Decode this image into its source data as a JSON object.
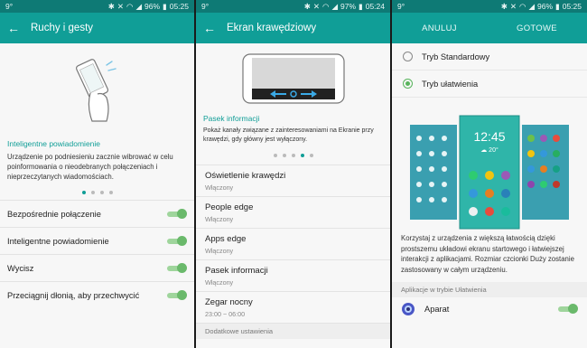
{
  "status1": {
    "left": "9°",
    "battery": "96%",
    "time": "05:25"
  },
  "status2": {
    "left": "9°",
    "battery": "97%",
    "time": "05:24"
  },
  "status3": {
    "left": "9°",
    "battery": "96%",
    "time": "05:25"
  },
  "panel1": {
    "title": "Ruchy i gesty",
    "section": "Inteligentne powiadomienie",
    "description": "Urządzenie po podniesieniu zacznie wibrować w celu poinformowania o nieodebranych połączeniach i nieprzeczytanych wiadomościach.",
    "toggles": [
      {
        "label": "Bezpośrednie połączenie",
        "on": true
      },
      {
        "label": "Inteligentne powiadomienie",
        "on": true
      },
      {
        "label": "Wycisz",
        "on": true
      },
      {
        "label": "Przeciągnij dłonią, aby przechwycić",
        "on": true
      }
    ]
  },
  "panel2": {
    "title": "Ekran krawędziowy",
    "section": "Pasek informacji",
    "description": "Pokaż kanały związane z zainteresowaniami na Ekranie przy krawędzi, gdy główny jest wyłączony.",
    "items": [
      {
        "title": "Oświetlenie krawędzi",
        "sub": "Włączony"
      },
      {
        "title": "People edge",
        "sub": "Włączony"
      },
      {
        "title": "Apps edge",
        "sub": "Włączony"
      },
      {
        "title": "Pasek informacji",
        "sub": "Włączony"
      },
      {
        "title": "Zegar nocny",
        "sub": "23:00 ~ 06:00"
      }
    ],
    "group": "Dodatkowe ustawienia"
  },
  "panel3": {
    "cancel": "ANULUJ",
    "done": "GOTOWE",
    "radios": [
      {
        "label": "Tryb Standardowy",
        "checked": false
      },
      {
        "label": "Tryb ułatwienia",
        "checked": true
      }
    ],
    "phone_time": "12:45",
    "phone_temp": "20°",
    "description": "Korzystaj z urządzenia z większą łatwością dzięki prostszemu układowi ekranu startowego i łatwiejszej interakcji z aplikacjami. Rozmiar czcionki Duży zostanie zastosowany w całym urządzeniu.",
    "group": "Aplikacje w trybie Ułatwienia",
    "apps": [
      {
        "label": "Aparat",
        "on": true
      }
    ]
  },
  "colors": {
    "accent": "#109e97",
    "statusbar": "#0e7a75",
    "toggle_on": "#6ab96b"
  }
}
